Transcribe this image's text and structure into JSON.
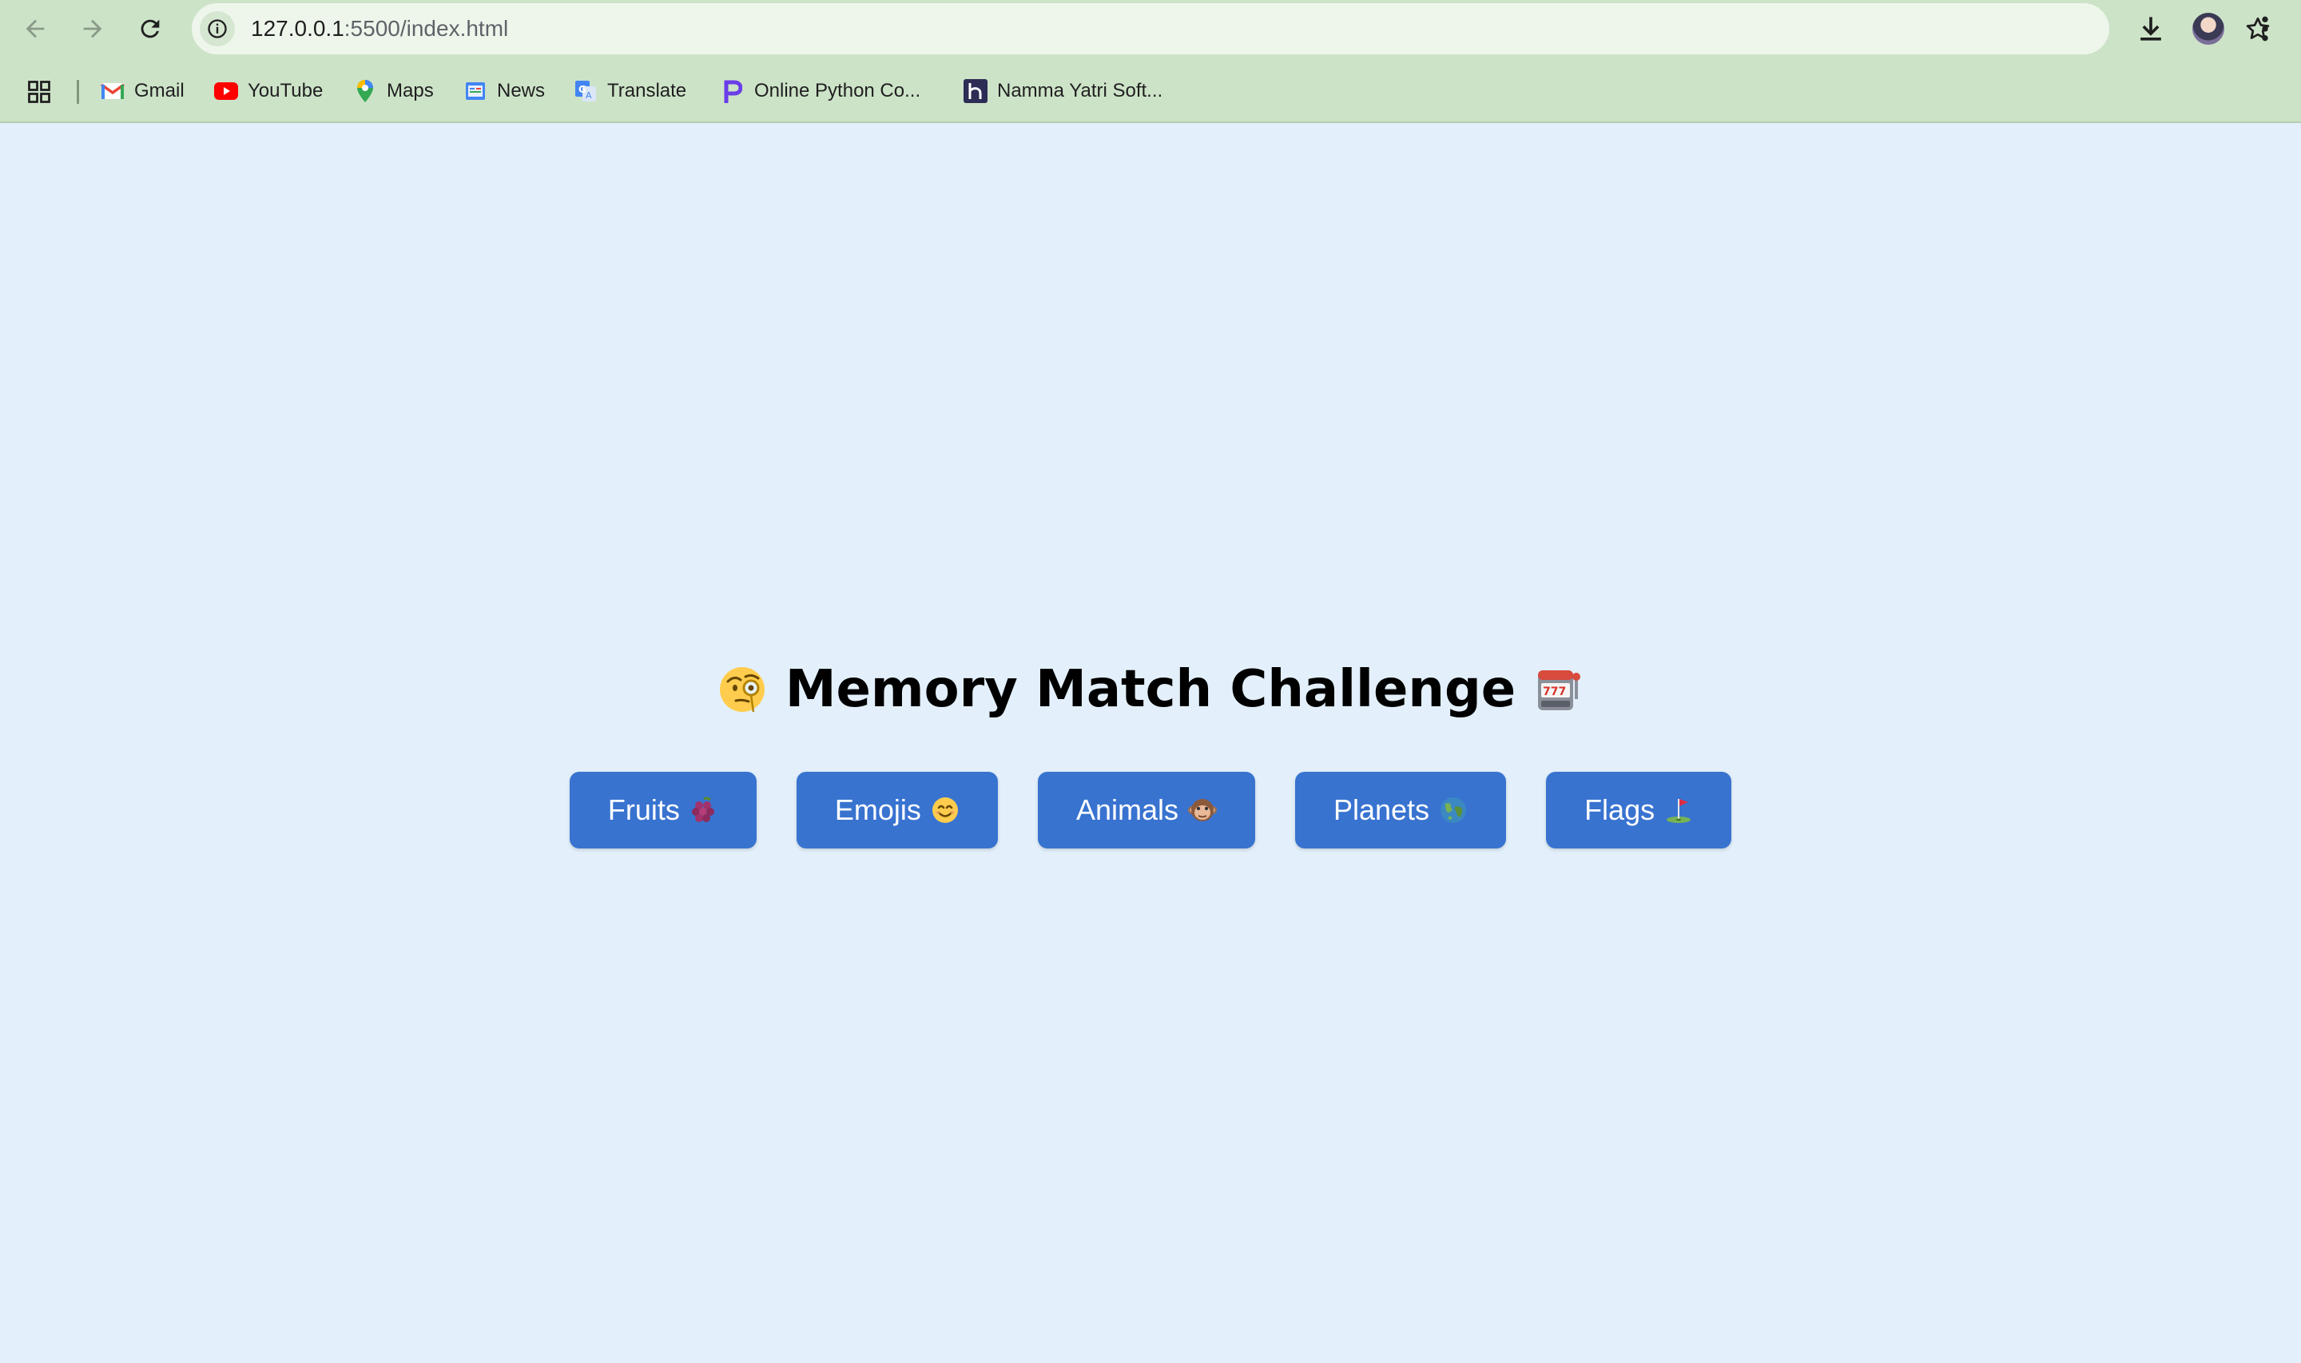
{
  "browser": {
    "url_host": "127.0.0.1",
    "url_rest": ":5500/index.html",
    "bookmarks": [
      {
        "label": "Gmail",
        "icon": "gmail-icon"
      },
      {
        "label": "YouTube",
        "icon": "youtube-icon"
      },
      {
        "label": "Maps",
        "icon": "maps-icon"
      },
      {
        "label": "News",
        "icon": "news-icon"
      },
      {
        "label": "Translate",
        "icon": "translate-icon"
      },
      {
        "label": "Online Python Co...",
        "icon": "python-compiler-icon"
      },
      {
        "label": "Namma Yatri Soft...",
        "icon": "namma-yatri-icon"
      }
    ]
  },
  "page": {
    "title": "Memory Match Challenge",
    "title_left_icon": "face-with-monocle-icon",
    "title_right_icon": "slot-machine-icon",
    "categories": [
      {
        "label": "Fruits",
        "icon": "grapes-icon"
      },
      {
        "label": "Emojis",
        "icon": "smiling-face-icon"
      },
      {
        "label": "Animals",
        "icon": "monkey-face-icon"
      },
      {
        "label": "Planets",
        "icon": "globe-icon"
      },
      {
        "label": "Flags",
        "icon": "golf-flag-icon"
      }
    ]
  },
  "colors": {
    "page_background": "#e3f0fb",
    "button": "#3873d0",
    "chrome": "#cde3c8"
  }
}
